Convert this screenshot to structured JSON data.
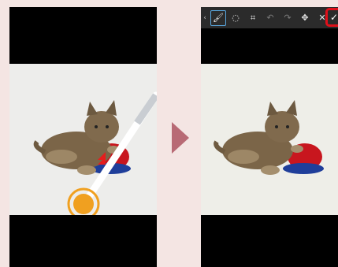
{
  "comparison": {
    "left_caption": "",
    "right_caption": ""
  },
  "editor_toolbar": {
    "tools": [
      {
        "id": "back",
        "icon": "chevron-left-icon",
        "glyph": "‹"
      },
      {
        "id": "brush",
        "icon": "brush-icon",
        "glyph": "🖌"
      },
      {
        "id": "eraser",
        "icon": "eraser-icon",
        "glyph": "◌"
      },
      {
        "id": "crop",
        "icon": "crop-icon",
        "glyph": "⌗"
      },
      {
        "id": "undo",
        "icon": "undo-icon",
        "glyph": "↶"
      },
      {
        "id": "redo",
        "icon": "redo-icon",
        "glyph": "↷"
      },
      {
        "id": "move",
        "icon": "move-icon",
        "glyph": "✥"
      },
      {
        "id": "cancel",
        "icon": "close-icon",
        "glyph": "✕"
      },
      {
        "id": "confirm",
        "icon": "check-icon",
        "glyph": "✓"
      }
    ],
    "active_tool": "brush",
    "highlighted_tool": "confirm"
  },
  "colors": {
    "background": "#f4e5e3",
    "arrow": "#b86a75",
    "stylus_ring": "#f0a020",
    "highlight_box": "#e0101a",
    "active_tool_border": "#5aa8e0"
  }
}
